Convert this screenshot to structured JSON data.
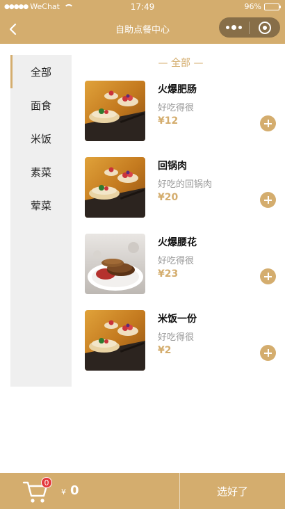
{
  "status_bar": {
    "carrier": "WeChat",
    "time": "17:49",
    "battery": "96%"
  },
  "nav": {
    "title": "自助点餐中心"
  },
  "categories": [
    {
      "label": "全部"
    },
    {
      "label": "面食"
    },
    {
      "label": "米饭"
    },
    {
      "label": "素菜"
    },
    {
      "label": "荤菜"
    }
  ],
  "section_title": "— 全部 —",
  "dishes": [
    {
      "name": "火爆肥肠",
      "desc": "好吃得很",
      "price": "¥12",
      "image": "dessert-tart-photo"
    },
    {
      "name": "回锅肉",
      "desc": "好吃的回锅肉",
      "price": "¥20",
      "image": "dessert-tart-photo"
    },
    {
      "name": "火爆腰花",
      "desc": "好吃得很",
      "price": "¥23",
      "image": "pancake-berry-photo"
    },
    {
      "name": "米饭一份",
      "desc": "好吃得很",
      "price": "¥2",
      "image": "dessert-tart-photo"
    }
  ],
  "cart": {
    "badge": "0",
    "currency": "¥",
    "total": "0"
  },
  "checkout_label": "选好了",
  "colors": {
    "accent": "#d4ad6e",
    "badge": "#e4393c",
    "sidebar_bg": "#efefef"
  }
}
